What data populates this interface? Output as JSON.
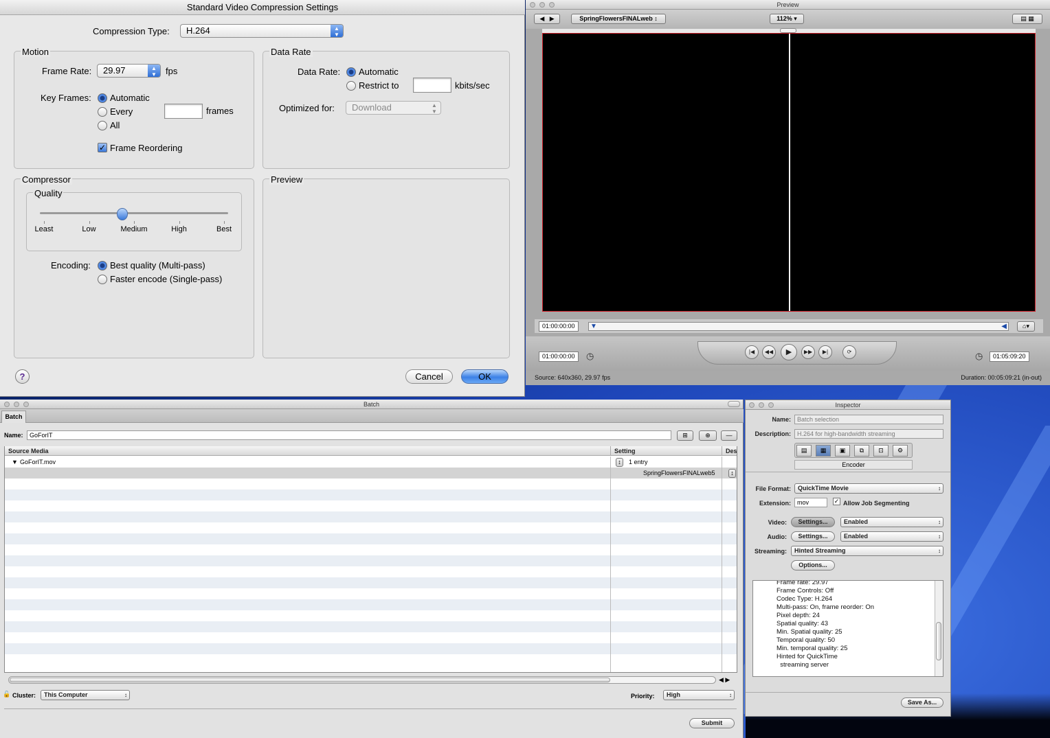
{
  "compression": {
    "title": "Standard Video Compression Settings",
    "compression_type_label": "Compression Type:",
    "compression_type": "H.264",
    "motion": {
      "title": "Motion",
      "frame_rate_label": "Frame Rate:",
      "frame_rate": "29.97",
      "frame_rate_unit": "fps",
      "key_frames_label": "Key Frames:",
      "key_automatic": "Automatic",
      "key_every": "Every",
      "key_all": "All",
      "frames_unit": "frames",
      "frame_reordering": "Frame Reordering"
    },
    "data_rate": {
      "title": "Data Rate",
      "label": "Data Rate:",
      "automatic": "Automatic",
      "restrict": "Restrict to",
      "unit": "kbits/sec",
      "optimized_label": "Optimized for:",
      "optimized": "Download"
    },
    "compressor": {
      "title": "Compressor",
      "quality_title": "Quality",
      "ticks": [
        "Least",
        "Low",
        "Medium",
        "High",
        "Best"
      ],
      "quality_level": 0.5,
      "encoding_label": "Encoding:",
      "best": "Best quality (Multi-pass)",
      "faster": "Faster encode (Single-pass)"
    },
    "preview_title": "Preview",
    "help": "?",
    "cancel": "Cancel",
    "ok": "OK"
  },
  "preview": {
    "title": "Preview",
    "source_popup": "SpringFlowersFINALweb",
    "zoom": "112%",
    "timecode_in": "01:00:00:00",
    "timecode_current": "01:00:00:00",
    "timecode_duration": "01:05:09:20",
    "source_info": "Source: 640x360, 29.97 fps",
    "duration_info": "Duration: 00:05:09:21 (in-out)"
  },
  "batch": {
    "title": "Batch",
    "tab": "Batch",
    "name_label": "Name:",
    "name": "GoForIT",
    "columns": [
      "Source Media",
      "Setting",
      "Des"
    ],
    "source_file": "GoForIT.mov",
    "entry_count": "1 entry",
    "setting": "SpringFlowersFINALweb5",
    "cluster_label": "Cluster:",
    "cluster": "This Computer",
    "priority_label": "Priority:",
    "priority": "High",
    "submit": "Submit"
  },
  "inspector": {
    "title": "Inspector",
    "name_label": "Name:",
    "name": "Batch selection",
    "description_label": "Description:",
    "description": "H.264 for high-bandwidth streaming",
    "tab": "Encoder",
    "file_format_label": "File Format:",
    "file_format": "QuickTime Movie",
    "extension_label": "Extension:",
    "extension": "mov",
    "allow_segmenting": "Allow Job Segmenting",
    "video_label": "Video:",
    "video_settings": "Settings...",
    "video_state": "Enabled",
    "audio_label": "Audio:",
    "audio_settings": "Settings...",
    "audio_state": "Enabled",
    "streaming_label": "Streaming:",
    "streaming": "Hinted Streaming",
    "options": "Options...",
    "summary": [
      "Frame rate: 29.97",
      "Frame Controls: Off",
      "Codec Type: H.264",
      "Multi-pass: On, frame reorder: On",
      "Pixel depth: 24",
      "Spatial quality: 43",
      "Min. Spatial quality: 25",
      "Temporal quality: 50",
      "Min. temporal quality: 25",
      "Hinted for QuickTime",
      "  streaming server"
    ],
    "save_as": "Save As..."
  }
}
